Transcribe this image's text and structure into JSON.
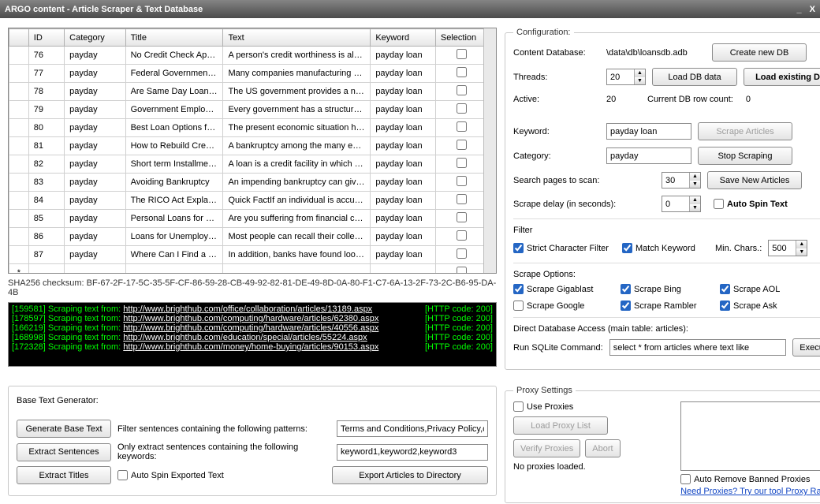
{
  "window": {
    "title": "ARGO content - Article Scraper & Text Database"
  },
  "grid": {
    "headers": {
      "id": "ID",
      "category": "Category",
      "title": "Title",
      "text": "Text",
      "keyword": "Keyword",
      "selection": "Selection"
    },
    "rows": [
      {
        "id": "76",
        "category": "payday",
        "title": "No Credit Check Apar...",
        "text": "A person's credit worthiness is alwa...",
        "keyword": "payday loan"
      },
      {
        "id": "77",
        "category": "payday",
        "title": "Federal Government ...",
        "text": "Many companies manufacturing co...",
        "keyword": "payday loan"
      },
      {
        "id": "78",
        "category": "payday",
        "title": "Are Same Day Loans ...",
        "text": "The US government provides a nu...",
        "keyword": "payday loan"
      },
      {
        "id": "79",
        "category": "payday",
        "title": "Government Employe...",
        "text": "Every government has a structure....",
        "keyword": "payday loan"
      },
      {
        "id": "80",
        "category": "payday",
        "title": "Best Loan Options for...",
        "text": "The present economic situation has...",
        "keyword": "payday loan"
      },
      {
        "id": "81",
        "category": "payday",
        "title": "How to Rebuild Credit...",
        "text": "A bankruptcy among the many eve...",
        "keyword": "payday loan"
      },
      {
        "id": "82",
        "category": "payday",
        "title": "Short term Installment ...",
        "text": "A loan is a credit facility in which th...",
        "keyword": "payday loan"
      },
      {
        "id": "83",
        "category": "payday",
        "title": "Avoiding Bankruptcy",
        "text": "An impending bankruptcy can give ...",
        "keyword": "payday loan"
      },
      {
        "id": "84",
        "category": "payday",
        "title": "The RICO Act Explain...",
        "text": "Quick FactIf an individual is accuse...",
        "keyword": "payday loan"
      },
      {
        "id": "85",
        "category": "payday",
        "title": "Personal Loans for Pe...",
        "text": "Are you suffering from financial crisi...",
        "keyword": "payday loan"
      },
      {
        "id": "86",
        "category": "payday",
        "title": "Loans for Unemploye...",
        "text": "Most people can recall their college...",
        "keyword": "payday loan"
      },
      {
        "id": "87",
        "category": "payday",
        "title": "Where Can I Find a B...",
        "text": "In addition, banks have found loop...",
        "keyword": "payday loan"
      }
    ]
  },
  "checksum_label": "SHA256 checksum: BF-67-2F-17-5C-35-5F-CF-86-59-28-CB-49-92-82-81-DE-49-8D-0A-80-F1-C7-6A-13-2F-73-2C-B6-95-DA-4B",
  "console_lines": [
    {
      "id": "[159581]",
      "msg": " Scraping text from: ",
      "url": "http://www.brighthub.com/office/collaboration/articles/13189.aspx",
      "code": "[HTTP code: 200]"
    },
    {
      "id": "[178597]",
      "msg": " Scraping text from: ",
      "url": "http://www.brighthub.com/computing/hardware/articles/62380.aspx",
      "code": "[HTTP code: 200]"
    },
    {
      "id": "[166219]",
      "msg": " Scraping text from: ",
      "url": "http://www.brighthub.com/computing/hardware/articles/40556.aspx",
      "code": "[HTTP code: 200]"
    },
    {
      "id": "[168998]",
      "msg": " Scraping text from: ",
      "url": "http://www.brighthub.com/education/special/articles/55224.aspx",
      "code": "[HTTP code: 200]"
    },
    {
      "id": "[172328]",
      "msg": " Scraping text from: ",
      "url": "http://www.brighthub.com/money/home-buying/articles/90153.aspx",
      "code": "[HTTP code: 200]"
    }
  ],
  "generator": {
    "title": "Base Text Generator:",
    "generate_btn": "Generate Base Text",
    "extract_sentences_btn": "Extract Sentences",
    "extract_titles_btn": "Extract Titles",
    "filter_label": "Filter sentences containing the following patterns:",
    "only_extract_label": "Only extract sentences containing the following keywords:",
    "filter_value": "Terms and Conditions,Privacy Policy,copy",
    "keywords_value": "keyword1,keyword2,keyword3",
    "auto_spin_label": "Auto Spin Exported Text",
    "export_btn": "Export Articles to Directory"
  },
  "config": {
    "legend": "Configuration:",
    "db_label": "Content Database:",
    "db_value": "\\data\\db\\loansdb.adb",
    "create_db_btn": "Create new DB",
    "threads_label": "Threads:",
    "threads_value": "20",
    "load_db_btn": "Load DB data",
    "load_existing_btn": "Load existing DB",
    "active_label": "Active:",
    "active_value": "20",
    "rowcount_label": "Current DB row count:",
    "rowcount_value": "0",
    "keyword_label": "Keyword:",
    "keyword_value": "payday loan",
    "category_label": "Category:",
    "category_value": "payday",
    "scrape_articles_btn": "Scrape Articles",
    "stop_scraping_btn": "Stop Scraping",
    "save_new_btn": "Save New Articles",
    "pages_label": "Search pages to scan:",
    "pages_value": "30",
    "delay_label": "Scrape delay (in seconds):",
    "delay_value": "0",
    "auto_spin_text_label": "Auto Spin Text",
    "filter_legend": "Filter",
    "strict_label": "Strict Character Filter",
    "match_kw_label": "Match Keyword",
    "min_chars_label": "Min. Chars.:",
    "min_chars_value": "500",
    "scrape_options_legend": "Scrape Options:",
    "sg": "Scrape Gigablast",
    "sb": "Scrape Bing",
    "sa": "Scrape AOL",
    "sgo": "Scrape Google",
    "sr": "Scrape Rambler",
    "sk": "Scrape Ask",
    "dda_label": "Direct Database Access (main table: articles):",
    "run_sql_label": "Run SQLite Command:",
    "sql_value": "select * from articles where text like",
    "execute_btn": "Execute"
  },
  "proxy": {
    "legend": "Proxy Settings",
    "use_proxies": "Use Proxies",
    "load_list_btn": "Load Proxy List",
    "verify_btn": "Verify Proxies",
    "abort_btn": "Abort",
    "status": "No proxies loaded.",
    "auto_remove": "Auto Remove Banned Proxies",
    "need_link": "Need Proxies? Try our tool Proxy Raider!"
  }
}
